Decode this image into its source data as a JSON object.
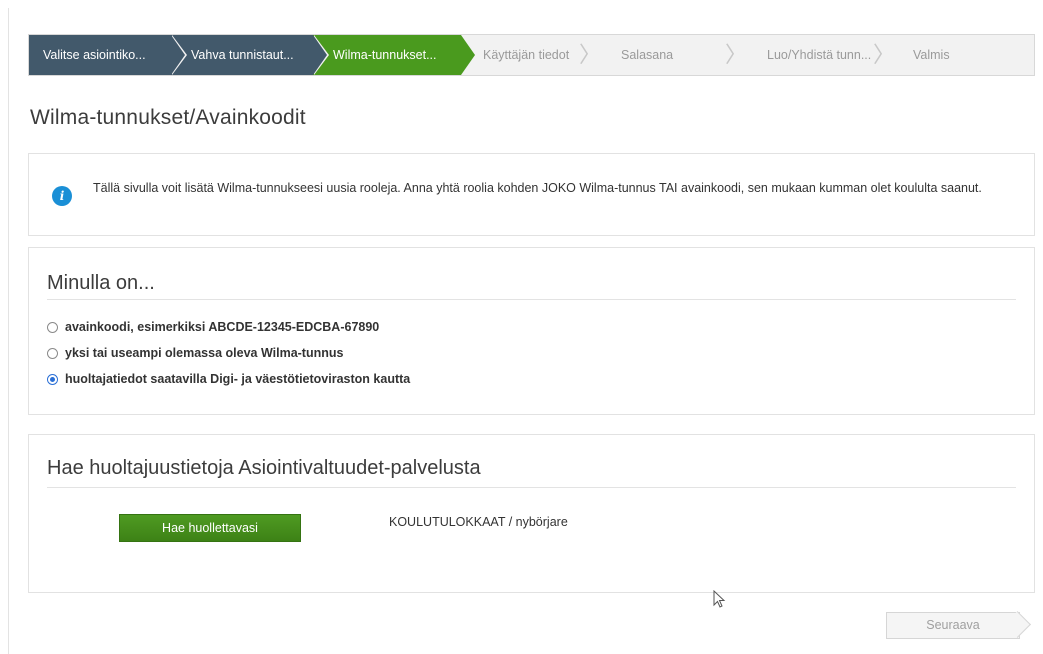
{
  "wizard": {
    "steps": [
      {
        "label": "Valitse asiointiko...",
        "state": "done"
      },
      {
        "label": "Vahva tunnistaut...",
        "state": "done"
      },
      {
        "label": "Wilma-tunnukset...",
        "state": "active"
      },
      {
        "label": "Käyttäjän tiedot",
        "state": "pending"
      },
      {
        "label": "Salasana",
        "state": "pending"
      },
      {
        "label": "Luo/Yhdistä tunn...",
        "state": "pending"
      },
      {
        "label": "Valmis",
        "state": "pending"
      }
    ]
  },
  "page": {
    "title": "Wilma-tunnukset/Avainkoodit"
  },
  "info": {
    "icon": "info-icon",
    "text": "Tällä sivulla voit lisätä Wilma-tunnukseesi uusia rooleja. Anna yhtä roolia kohden JOKO Wilma-tunnus TAI avainkoodi, sen mukaan kumman olet koululta saanut."
  },
  "choice": {
    "heading": "Minulla on...",
    "options": [
      {
        "label": "avainkoodi, esimerkiksi ABCDE-12345-EDCBA-67890",
        "selected": false
      },
      {
        "label": "yksi tai useampi olemassa oleva Wilma-tunnus",
        "selected": false
      },
      {
        "label": "huoltajatiedot saatavilla Digi- ja väestötietoviraston kautta",
        "selected": true
      }
    ]
  },
  "fetch": {
    "heading": "Hae huoltajuustietoja Asiointivaltuudet-palvelusta",
    "button_label": "Hae huollettavasi",
    "org_text": "KOULUTULOKKAAT / nybörjare"
  },
  "footer": {
    "next_label": "Seuraava"
  },
  "colors": {
    "step_done": "#42596b",
    "step_active": "#4a9a1e",
    "primary_button": "#3d8216",
    "info_icon": "#1a8fd6"
  }
}
